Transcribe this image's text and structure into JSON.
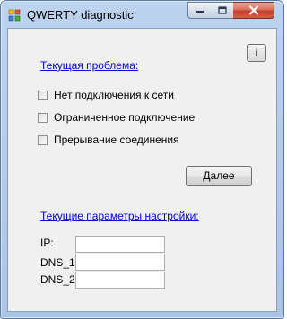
{
  "window": {
    "title": "QWERTY diagnostic",
    "icon": "app-icon",
    "controls": {
      "minimize": "minimize-icon",
      "maximize": "maximize-icon",
      "close": "close-icon"
    }
  },
  "info_button": {
    "label": "i"
  },
  "problem_section": {
    "heading": "Текущая проблема:",
    "options": [
      {
        "label": "Нет подключения к сети",
        "checked": false
      },
      {
        "label": "Ограниченное подключение",
        "checked": false
      },
      {
        "label": "Прерывание соединения",
        "checked": false
      }
    ]
  },
  "next_button": {
    "label": "Далее"
  },
  "settings_section": {
    "heading": "Текущие параметры настройки:",
    "fields": [
      {
        "label": "IP:",
        "value": ""
      },
      {
        "label": "DNS_1:",
        "value": ""
      },
      {
        "label": "DNS_2:",
        "value": ""
      }
    ]
  },
  "colors": {
    "link": "#0000ee",
    "client_bg": "#f0f0f0",
    "title_bg": "#bcd3ee",
    "close_red": "#c4402b"
  }
}
